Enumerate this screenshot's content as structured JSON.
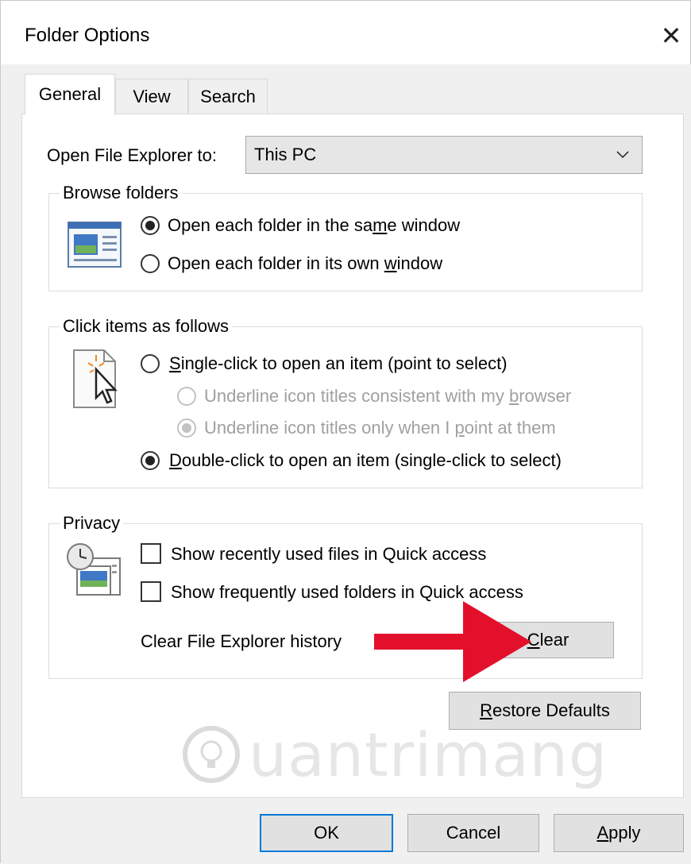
{
  "window": {
    "title": "Folder Options",
    "close_glyph": "✕"
  },
  "tabs": [
    {
      "label": "General",
      "active": true
    },
    {
      "label": "View",
      "active": false
    },
    {
      "label": "Search",
      "active": false
    }
  ],
  "open_to": {
    "label": "Open File Explorer to:",
    "value": "This PC"
  },
  "browse": {
    "legend": "Browse folders",
    "icon": "window-layout-icon",
    "opt1": {
      "pre": "Open each folder in the sa",
      "ul": "m",
      "post": "e window",
      "checked": true
    },
    "opt2": {
      "pre": "Open each folder in its own ",
      "ul": "w",
      "post": "indow",
      "checked": false
    }
  },
  "click": {
    "legend": "Click items as follows",
    "icon": "pointer-click-icon",
    "single": {
      "ul": "S",
      "post": "ingle-click to open an item (point to select)",
      "checked": false
    },
    "underline_browser": {
      "pre": "Underline icon titles consistent with my ",
      "ul": "b",
      "post": "rowser",
      "checked": false
    },
    "underline_point": {
      "pre": "Underline icon titles only when I ",
      "ul": "p",
      "post": "oint at them",
      "checked": true
    },
    "double": {
      "ul": "D",
      "post": "ouble-click to open an item (single-click to select)",
      "checked": true
    }
  },
  "privacy": {
    "legend": "Privacy",
    "icon": "clock-documents-icon",
    "recent": {
      "label": "Show recently used files in Quick access",
      "checked": false
    },
    "frequent": {
      "label": "Show frequently used folders in Quick access",
      "checked": false
    },
    "history_label": "Clear File Explorer history",
    "clear": {
      "ul": "C",
      "post": "lear"
    }
  },
  "restore": {
    "ul": "R",
    "post": "estore Defaults"
  },
  "footer": {
    "ok": "OK",
    "cancel": "Cancel",
    "apply": {
      "ul": "A",
      "post": "pply"
    }
  },
  "watermark": "uantrimang",
  "colors": {
    "arrow": "#e3102c",
    "focus_border": "#0078d7",
    "accent_icon": "#2e6db4"
  }
}
